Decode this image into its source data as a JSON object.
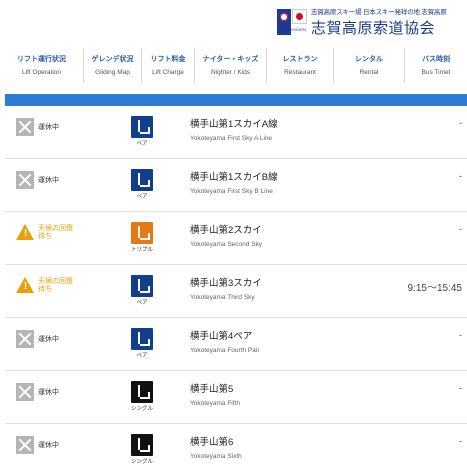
{
  "header": {
    "logo_subtitle": "志賀高原スキー場 日本スキー発祥の地 志賀高原",
    "logo_title": "志賀高原索道協会",
    "logo_caption": "SHIGA KOGEN"
  },
  "nav": [
    {
      "jp": "リフト運行状況",
      "en": "Lift Operation"
    },
    {
      "jp": "ゲレンデ状況",
      "en": "Gliding Map"
    },
    {
      "jp": "リフト料金",
      "en": "Lift Charge"
    },
    {
      "jp": "ナイター・キッズ",
      "en": "Nighter / Kids"
    },
    {
      "jp": "レストラン",
      "en": "Restaurant"
    },
    {
      "jp": "レンタル",
      "en": "Rental"
    },
    {
      "jp": "バス時刻",
      "en": "Bus Timet"
    }
  ],
  "lifts": [
    {
      "status": "運休中",
      "status_type": "stop",
      "type_label": "ペア",
      "type_class": "pair",
      "name_jp": "横手山第1スカイA線",
      "name_en": "Yokoteyama First Sky A Line",
      "hours": "-"
    },
    {
      "status": "運休中",
      "status_type": "stop",
      "type_label": "ペア",
      "type_class": "pair",
      "name_jp": "横手山第1スカイB線",
      "name_en": "Yokoteyama First Sky B Line",
      "hours": "-"
    },
    {
      "status": "天候の回復待ち",
      "status_type": "wait",
      "type_label": "トリプル",
      "type_class": "double",
      "name_jp": "横手山第2スカイ",
      "name_en": "Yokoteyama Second Sky",
      "hours": "-"
    },
    {
      "status": "天候の回復待ち",
      "status_type": "wait",
      "type_label": "ペア",
      "type_class": "pair",
      "name_jp": "横手山第3スカイ",
      "name_en": "Yokoteyama Third Sky",
      "hours": "9:15〜15:45"
    },
    {
      "status": "運休中",
      "status_type": "stop",
      "type_label": "ペア",
      "type_class": "pair",
      "name_jp": "横手山第4ペア",
      "name_en": "Yokoteyama Fourth Pair",
      "hours": "-"
    },
    {
      "status": "運休中",
      "status_type": "stop",
      "type_label": "シングル",
      "type_class": "single",
      "name_jp": "横手山第5",
      "name_en": "Yokoteyama Fifth",
      "hours": "-"
    },
    {
      "status": "運休中",
      "status_type": "stop",
      "type_label": "シングル",
      "type_class": "single",
      "name_jp": "横手山第6",
      "name_en": "Yokoteyama Sixth",
      "hours": "-"
    }
  ],
  "colors": {
    "accent_bar": "#2b7cd3",
    "nav_text": "#2a5db0",
    "warning": "#e8a10a",
    "stopped": "#b5b5b5"
  }
}
